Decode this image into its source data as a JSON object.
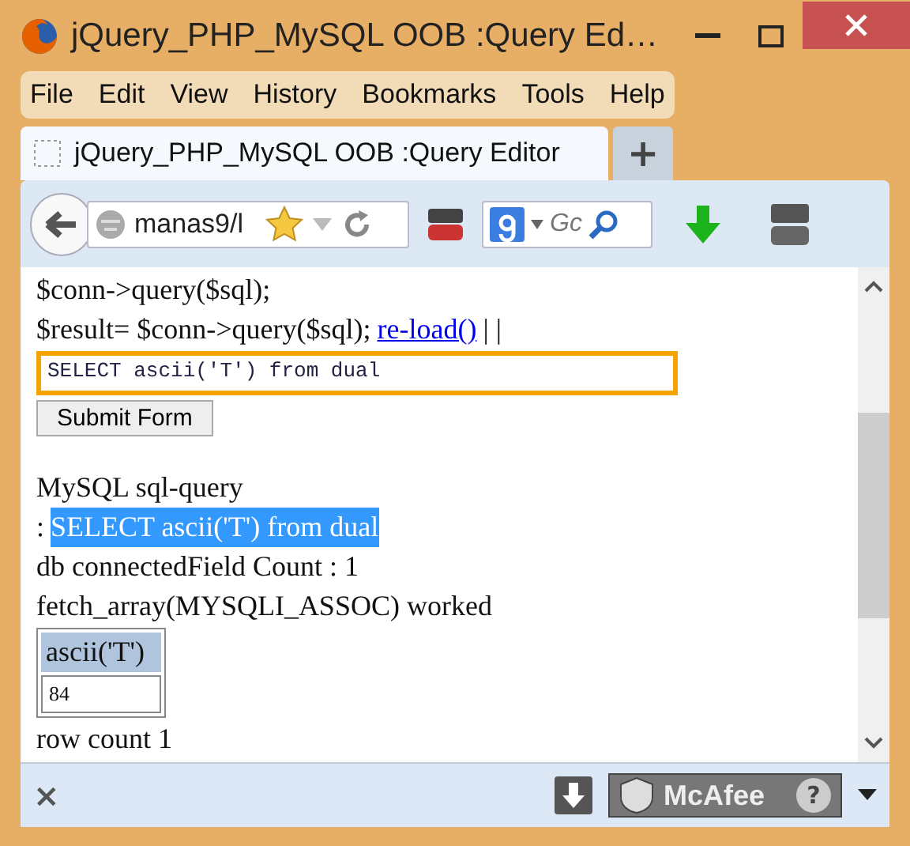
{
  "window": {
    "title": "jQuery_PHP_MySQL OOB :Query Ed…"
  },
  "menu": [
    "File",
    "Edit",
    "View",
    "History",
    "Bookmarks",
    "Tools",
    "Help"
  ],
  "tabs": [
    {
      "label": "jQuery_PHP_MySQL OOB :Query Editor",
      "selected": true
    }
  ],
  "new_tab": "+",
  "address": {
    "value": "manas9/l"
  },
  "search": {
    "placeholder": "Gc"
  },
  "content": {
    "code_lines": [
      "$conn->query($sql);",
      "$result= $conn->query($sql);"
    ],
    "link": "re-load()",
    "separator": "| |",
    "sql_field": {
      "value": "SELECT ascii('T') from dual"
    },
    "submit": "Submit Form",
    "heading": "MySQL sql-query",
    "query_line": {
      "prefix": ":",
      "query": "SELECT ascii('T') from dual",
      "highlighted": true
    },
    "lines": [
      "db connectedField Count : 1",
      "fetch_array(MYSQLI_ASSOC) worked"
    ],
    "table": {
      "columns": [
        "ascii('T')"
      ],
      "rows": [
        [
          "84"
        ]
      ]
    },
    "footer": "row count 1"
  },
  "addon_bar": {
    "close": "×",
    "badge": "McAfee",
    "help": "?"
  }
}
